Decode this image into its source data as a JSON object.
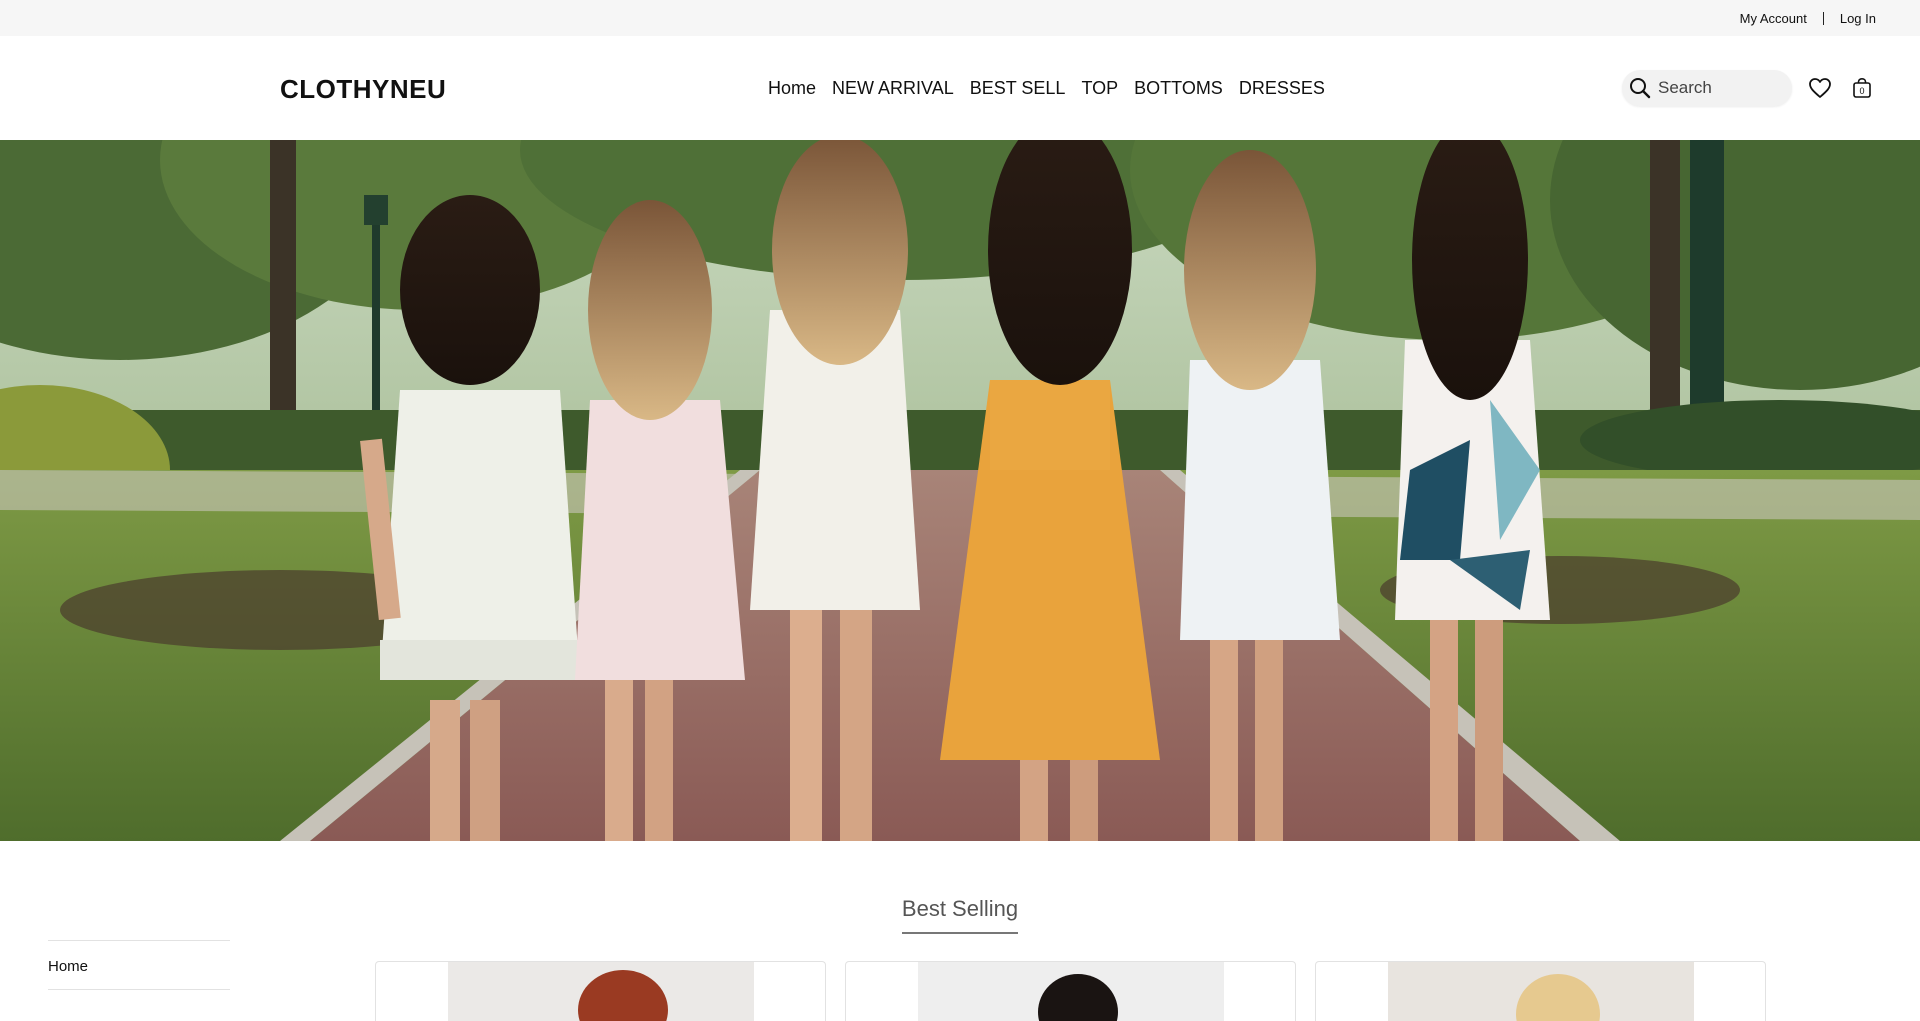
{
  "topbar": {
    "my_account": "My Account",
    "log_in": "Log In"
  },
  "header": {
    "logo": "CLOTHYNEU",
    "nav": [
      "Home",
      "NEW ARRIVAL",
      "BEST SELL",
      "TOP",
      "BOTTOMS",
      "DRESSES"
    ],
    "search_placeholder": "Search",
    "cart_count": "0"
  },
  "sidebar": {
    "items": [
      "Home"
    ]
  },
  "best_selling": {
    "title": "Best Selling"
  },
  "icons": {
    "search": "search-icon",
    "wishlist": "heart-icon",
    "cart": "shopping-bag-icon"
  }
}
